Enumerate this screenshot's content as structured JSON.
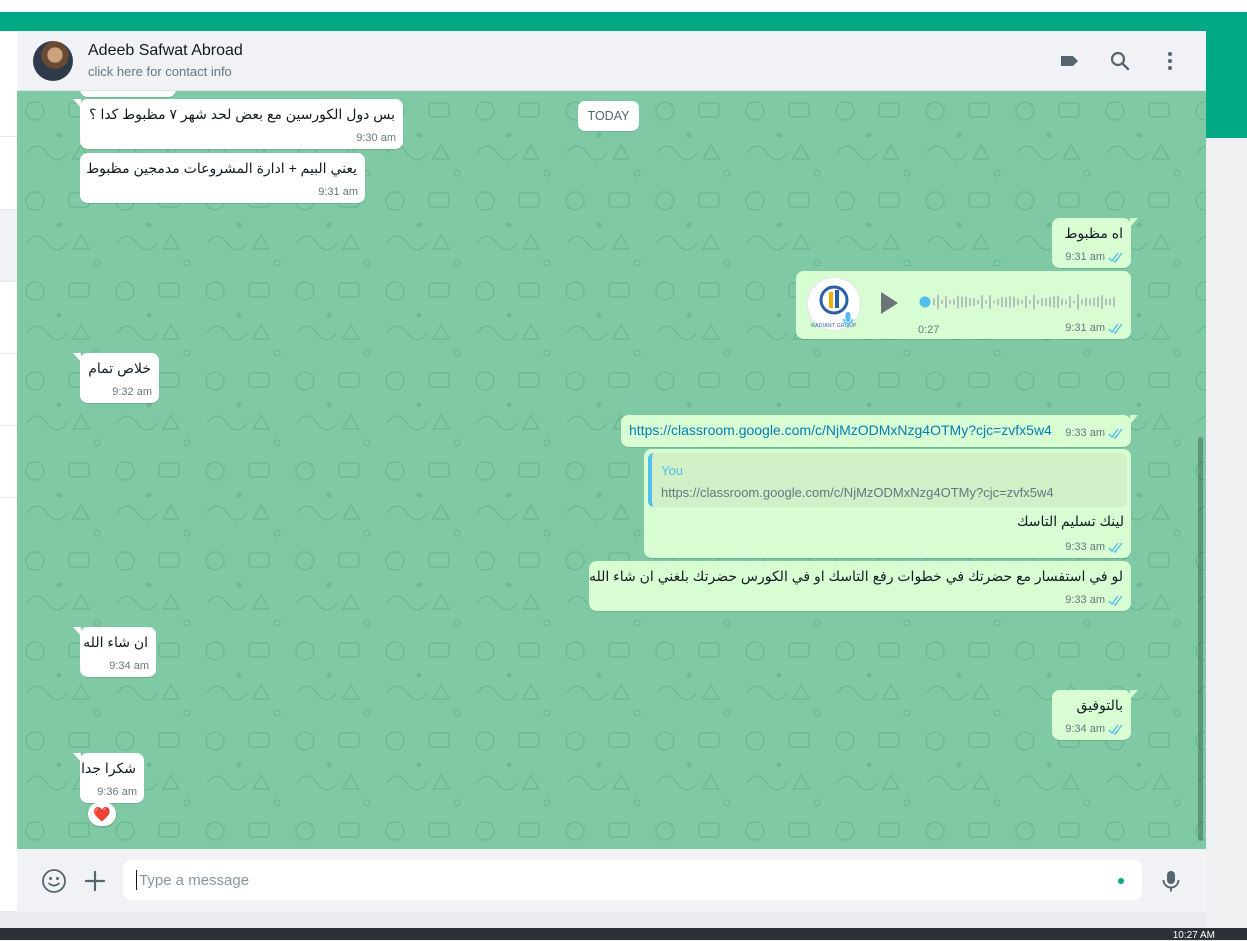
{
  "contact": {
    "name": "Adeeb Safwat Abroad",
    "subtitle": "click here for contact info"
  },
  "header_icons": [
    "label-icon",
    "search-icon",
    "menu-icon"
  ],
  "date_chip": "TODAY",
  "messages": [
    {
      "id": "m1",
      "direction": "in",
      "text": "بس دول الكورسين مع بعض لحد شهر ٧ مظبوط كدا ؟",
      "time": "9:30 am"
    },
    {
      "id": "m2",
      "direction": "in",
      "text": "يعني البيم + ادارة المشروعات مدمجين مظبوط",
      "time": "9:31 am"
    },
    {
      "id": "m3",
      "direction": "out",
      "text": "اه مظبوط",
      "time": "9:31 am",
      "status": "read"
    },
    {
      "id": "m4",
      "direction": "out",
      "type": "voice",
      "duration": "0:27",
      "time": "9:31 am",
      "status": "read",
      "avatar_label": "RADIANT GROUP"
    },
    {
      "id": "m5",
      "direction": "in",
      "text": "خلاص تمام",
      "time": "9:32 am"
    },
    {
      "id": "m6",
      "direction": "out",
      "type": "link",
      "text": "https://classroom.google.com/c/NjMzODMxNzg4OTMy?cjc=zvfx5w4",
      "time": "9:33 am",
      "status": "read"
    },
    {
      "id": "m7",
      "direction": "out",
      "type": "reply",
      "quote_name": "You",
      "quote_text": "https://classroom.google.com/c/NjMzODMxNzg4OTMy?cjc=zvfx5w4",
      "text": "لينك تسليم التاسك",
      "time": "9:33 am",
      "status": "read"
    },
    {
      "id": "m8",
      "direction": "out",
      "text": "لو في استفسار مع حضرتك في خطوات رفع التاسك او في الكورس حضرتك بلغني ان شاء الله",
      "time": "9:33 am",
      "status": "read"
    },
    {
      "id": "m9",
      "direction": "in",
      "text": "ان شاء الله",
      "time": "9:34 am"
    },
    {
      "id": "m10",
      "direction": "out",
      "text": "بالتوفيق",
      "time": "9:34 am",
      "status": "read"
    },
    {
      "id": "m11",
      "direction": "in",
      "text": "شكرا جدا",
      "time": "9:36 am",
      "reaction": "❤️"
    }
  ],
  "composer": {
    "placeholder": "Type a message"
  },
  "colors": {
    "brand": "#00a884",
    "chat_bg": "#7fcaa5",
    "outgoing_bubble": "#d9fdd3",
    "incoming_bubble": "#ffffff",
    "link": "#027eb5",
    "read_ticks": "#53bdeb"
  },
  "taskbar": {
    "clock": "10:27 AM"
  }
}
